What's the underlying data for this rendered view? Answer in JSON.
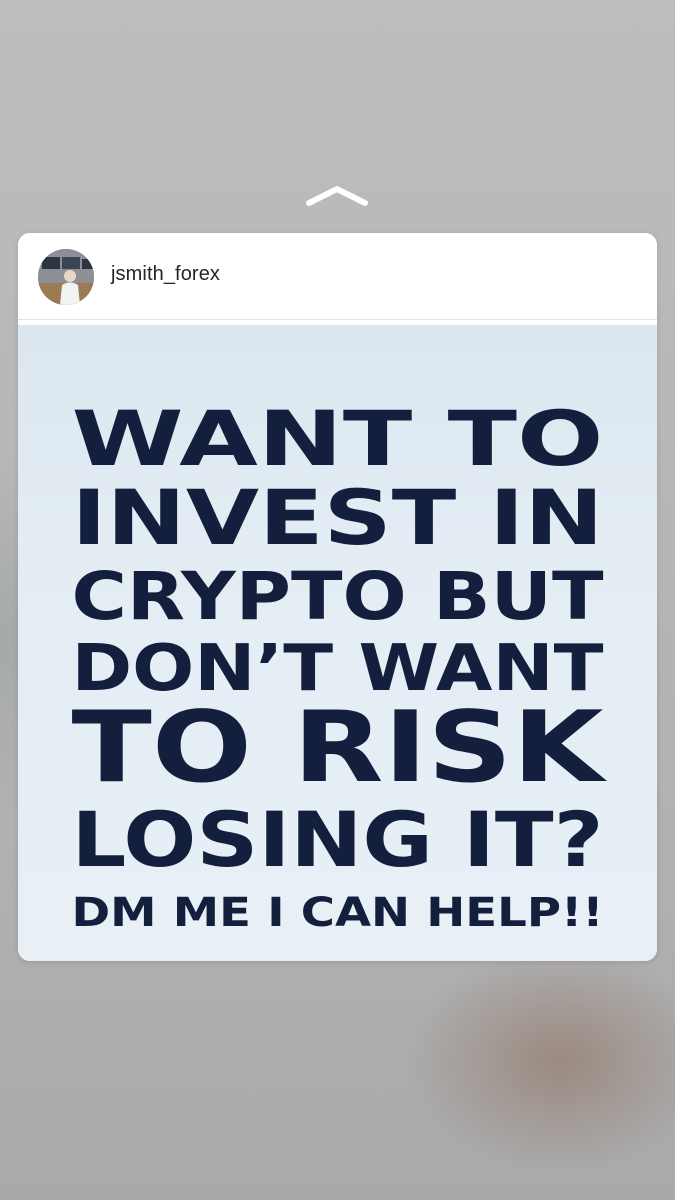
{
  "story": {
    "swipe_indicator": "chevron-up-icon"
  },
  "post": {
    "username": "jsmith_forex",
    "avatar": "trader-desk-avatar",
    "image_lines": [
      "WANT TO",
      "INVEST IN",
      "CRYPTO BUT",
      "DON’T WANT",
      "TO RISK",
      "LOSING IT?",
      "DM ME I CAN HELP!!"
    ],
    "text_color": "#131f3d"
  }
}
